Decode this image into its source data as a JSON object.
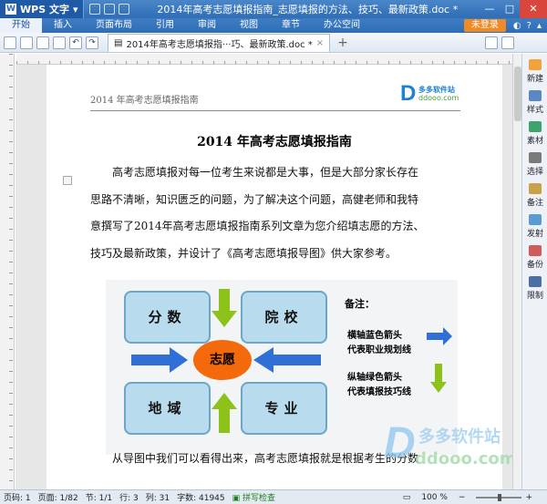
{
  "app": {
    "name": "WPS 文字",
    "logo_letter": "W",
    "window_title": "2014年高考志愿填报指南_志愿填报的方法、技巧、最新政策.doc *"
  },
  "window_controls": {
    "minimize": "—",
    "maximize": "□",
    "close": "✕"
  },
  "menu": {
    "items": [
      "开始",
      "插入",
      "页面布局",
      "引用",
      "审阅",
      "视图",
      "章节",
      "办公空间"
    ],
    "active": 0,
    "login": "未登录",
    "help": "?"
  },
  "toolbar": {
    "tab_label": "2014年高考志愿填报指···巧、最新政策.doc *",
    "tab_close": "×",
    "tab_add": "+"
  },
  "document": {
    "header_text": "2014 年高考志愿填报指南",
    "header_logo_cn": "多多软件站",
    "header_logo_url": "ddooo.com",
    "title": "2014 年高考志愿填报指南",
    "para1": [
      "　　高考志愿填报对每一位考生来说都是大事，但是大部分家长存在",
      "思路不清晰，知识匮乏的问题，为了解决这个问题，高健老师和我特",
      "意撰写了2014年高考志愿填报指南系列文章为您介绍填志愿的方法、",
      "技巧及最新政策，并设计了《高考志愿填报导图》供大家参考。"
    ],
    "para2": "　　从导图中我们可以看得出来，高考志愿填报就是根据考生的分数"
  },
  "figure": {
    "boxes": [
      "分数",
      "院校",
      "地域",
      "专业"
    ],
    "center": "志愿",
    "legend_title": "备注：",
    "legend_h1": "横轴蓝色箭头",
    "legend_h2": "代表职业规划线",
    "legend_v1": "纵轴绿色箭头",
    "legend_v2": "代表填报技巧线",
    "colors": {
      "box": "#b9dbee",
      "center": "#f5690d",
      "blue_arrow": "#2f6fd6",
      "green_arrow": "#8cc21a"
    }
  },
  "watermark": {
    "cn": "多多软件站",
    "url": "ddooo.com"
  },
  "sidepanel": [
    "新建",
    "样式",
    "素材",
    "选择",
    "备注",
    "发射",
    "备份",
    "限制"
  ],
  "status": {
    "page": "页码: 1",
    "pages": "页面: 1/82",
    "section": "节: 1/1",
    "row": "行: 3",
    "col": "列: 31",
    "words": "字数: 41945",
    "spell": "拼写检查",
    "zoom": "100 %"
  }
}
